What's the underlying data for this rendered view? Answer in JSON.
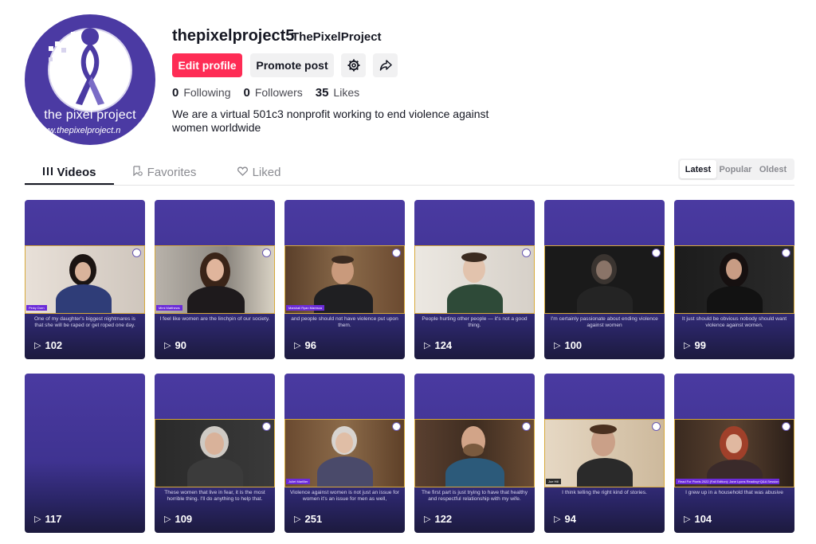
{
  "profile": {
    "avatar_text_line1": "the pixel project",
    "avatar_text_line2": "www.thepixelproject.n",
    "username": "thepixelproject5",
    "nickname": "ThePixelProject",
    "bio": "We are a virtual 501c3 nonprofit working to end violence against women worldwide"
  },
  "actions": {
    "edit_profile": "Edit profile",
    "promote_post": "Promote post",
    "settings_icon": "gear-icon",
    "share_icon": "share-icon"
  },
  "stats": [
    {
      "value": "0",
      "label": "Following"
    },
    {
      "value": "0",
      "label": "Followers"
    },
    {
      "value": "35",
      "label": "Likes"
    }
  ],
  "tabs": [
    {
      "label": "Videos",
      "icon": "grid-icon",
      "active": true
    },
    {
      "label": "Favorites",
      "icon": "bookmark-icon",
      "active": false
    },
    {
      "label": "Liked",
      "icon": "heart-icon",
      "active": false
    }
  ],
  "sort": [
    {
      "label": "Latest",
      "active": true
    },
    {
      "label": "Popular",
      "active": false
    },
    {
      "label": "Oldest",
      "active": false
    }
  ],
  "colors": {
    "accent": "#fe2c55",
    "card_purple": "#4a3aa1",
    "frame_border": "#d7a93a"
  },
  "videos": [
    {
      "plays": "102",
      "name_tag": "Pinky Dorn",
      "caption": "One of my daughter's biggest nightmares is that she will be raped or get roped one day."
    },
    {
      "plays": "90",
      "name_tag": "Mimi Matthews",
      "caption": "I feel like women are the linchpin of our society."
    },
    {
      "plays": "96",
      "name_tag": "Marshall Ryan Maresca",
      "caption": "and people should not have violence put upon them."
    },
    {
      "plays": "124",
      "name_tag": "",
      "caption": "People hurting other people — it's not a good thing."
    },
    {
      "plays": "100",
      "name_tag": "",
      "caption": "I'm certainly passionate about ending violence against women"
    },
    {
      "plays": "99",
      "name_tag": "",
      "caption": "It just should be obvious nobody should want violence against women."
    },
    {
      "plays": "117",
      "name_tag": "",
      "caption": ""
    },
    {
      "plays": "109",
      "name_tag": "",
      "caption": "These women that live in fear, it is the most horrible thing. I'll do anything to help that."
    },
    {
      "plays": "251",
      "name_tag": "Juliet Marillier",
      "caption": "Violence against women is not just an issue for women it's an issue for men as well,"
    },
    {
      "plays": "122",
      "name_tag": "",
      "caption": "The first part is just trying to have that healthy and respectful relationship with my wife."
    },
    {
      "plays": "94",
      "name_tag": "Joe Hill",
      "caption": "I think telling the right kind of stories."
    },
    {
      "plays": "104",
      "name_tag": "Read For Pixels 2022 (Fall Edition): Jane Lyons Reading+Q&A Session",
      "caption": "I grew up in a household that was abusive"
    }
  ]
}
